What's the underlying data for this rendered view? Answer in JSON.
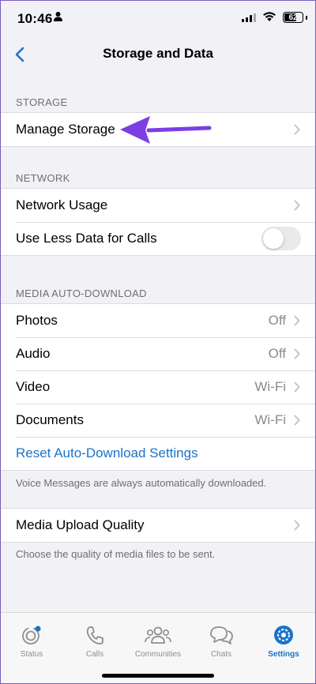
{
  "status_bar": {
    "time": "10:46",
    "battery": "62"
  },
  "nav": {
    "title": "Storage and Data"
  },
  "storage": {
    "header": "STORAGE",
    "manage_storage": "Manage Storage"
  },
  "network": {
    "header": "NETWORK",
    "network_usage": "Network Usage",
    "use_less_data": "Use Less Data for Calls",
    "use_less_data_enabled": false
  },
  "media_auto_download": {
    "header": "MEDIA AUTO-DOWNLOAD",
    "items": [
      {
        "label": "Photos",
        "value": "Off"
      },
      {
        "label": "Audio",
        "value": "Off"
      },
      {
        "label": "Video",
        "value": "Wi-Fi"
      },
      {
        "label": "Documents",
        "value": "Wi-Fi"
      }
    ],
    "reset": "Reset Auto-Download Settings",
    "footnote": "Voice Messages are always automatically downloaded."
  },
  "upload": {
    "label": "Media Upload Quality",
    "footnote": "Choose the quality of media files to be sent."
  },
  "tabs": [
    {
      "label": "Status"
    },
    {
      "label": "Calls"
    },
    {
      "label": "Communities"
    },
    {
      "label": "Chats"
    },
    {
      "label": "Settings",
      "active": true
    }
  ],
  "colors": {
    "accent": "#1a73c9",
    "annotation_arrow": "#7b3fe4"
  }
}
